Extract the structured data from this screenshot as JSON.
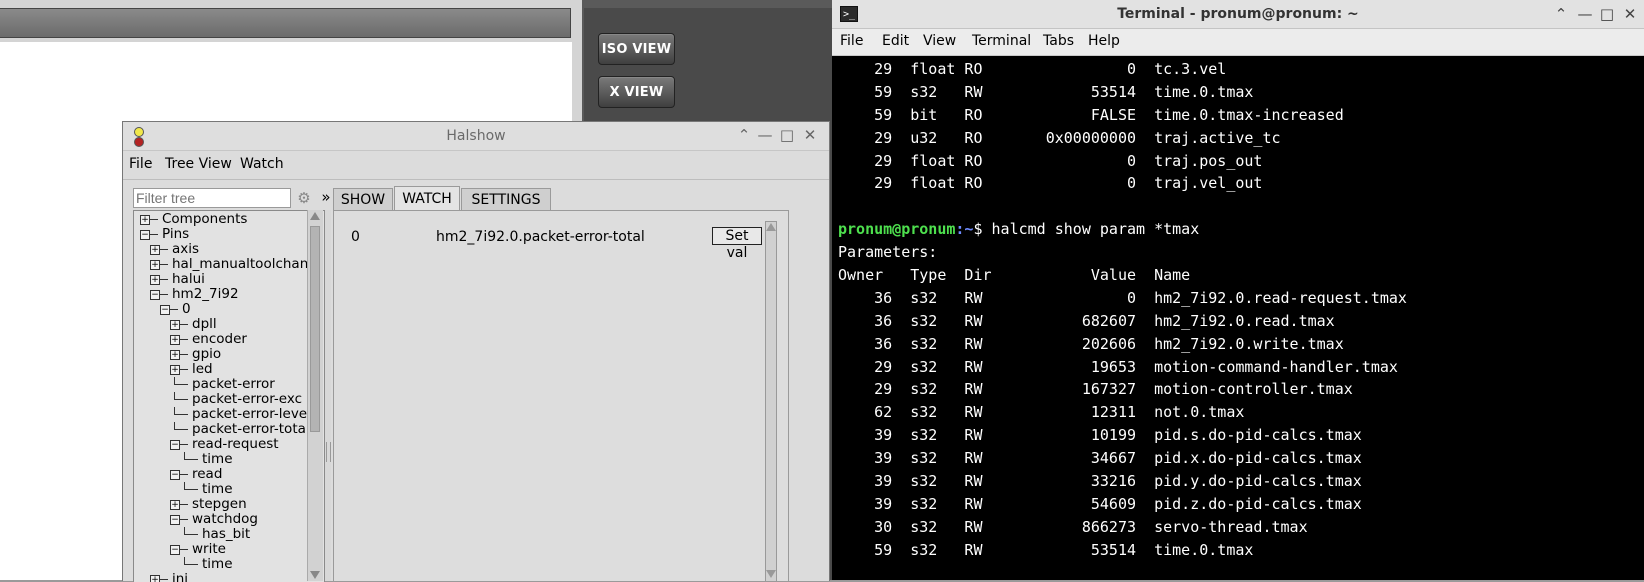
{
  "background_app": {
    "buttons": [
      "ISO VIEW",
      "X VIEW"
    ]
  },
  "halshow": {
    "title": "Halshow",
    "menu": [
      "File",
      "Tree View",
      "Watch"
    ],
    "filter_placeholder": "Filter tree",
    "more_glyph": "»",
    "tabs": [
      "SHOW",
      "WATCH",
      "SETTINGS"
    ],
    "active_tab": "WATCH",
    "tree": [
      {
        "label": "Components",
        "depth": 0,
        "expander": "+"
      },
      {
        "label": "Pins",
        "depth": 0,
        "expander": "-"
      },
      {
        "label": "axis",
        "depth": 1,
        "expander": "+"
      },
      {
        "label": "hal_manualtoolchan",
        "depth": 1,
        "expander": "+"
      },
      {
        "label": "halui",
        "depth": 1,
        "expander": "+"
      },
      {
        "label": "hm2_7i92",
        "depth": 1,
        "expander": "-"
      },
      {
        "label": "0",
        "depth": 2,
        "expander": "-"
      },
      {
        "label": "dpll",
        "depth": 3,
        "expander": "+"
      },
      {
        "label": "encoder",
        "depth": 3,
        "expander": "+"
      },
      {
        "label": "gpio",
        "depth": 3,
        "expander": "+"
      },
      {
        "label": "led",
        "depth": 3,
        "expander": "+"
      },
      {
        "label": "packet-error",
        "depth": 3,
        "expander": ""
      },
      {
        "label": "packet-error-exc",
        "depth": 3,
        "expander": ""
      },
      {
        "label": "packet-error-leve",
        "depth": 3,
        "expander": ""
      },
      {
        "label": "packet-error-tota",
        "depth": 3,
        "expander": ""
      },
      {
        "label": "read-request",
        "depth": 3,
        "expander": "-"
      },
      {
        "label": "time",
        "depth": 4,
        "expander": ""
      },
      {
        "label": "read",
        "depth": 3,
        "expander": "-"
      },
      {
        "label": "time",
        "depth": 4,
        "expander": ""
      },
      {
        "label": "stepgen",
        "depth": 3,
        "expander": "+"
      },
      {
        "label": "watchdog",
        "depth": 3,
        "expander": "-"
      },
      {
        "label": "has_bit",
        "depth": 4,
        "expander": ""
      },
      {
        "label": "write",
        "depth": 3,
        "expander": "-"
      },
      {
        "label": "time",
        "depth": 4,
        "expander": ""
      },
      {
        "label": "ini",
        "depth": 1,
        "expander": "+"
      }
    ],
    "watch": {
      "index": "0",
      "pin": "hm2_7i92.0.packet-error-total",
      "set_button": "Set val"
    }
  },
  "terminal": {
    "title": "Terminal - pronum@pronum: ~",
    "icon_glyph": ">_",
    "menu": [
      "File",
      "Edit",
      "View",
      "Terminal",
      "Tabs",
      "Help"
    ],
    "prev_rows": [
      [
        "29",
        "float",
        "RO",
        "0",
        "tc.3.vel"
      ],
      [
        "59",
        "s32",
        "RW",
        "53514",
        "time.0.tmax"
      ],
      [
        "59",
        "bit",
        "RO",
        "FALSE",
        "time.0.tmax-increased"
      ],
      [
        "29",
        "u32",
        "RO",
        "0x00000000",
        "traj.active_tc"
      ],
      [
        "29",
        "float",
        "RO",
        "0",
        "traj.pos_out"
      ],
      [
        "29",
        "float",
        "RO",
        "0",
        "traj.vel_out"
      ]
    ],
    "prompt_user": "pronum@pronum",
    "prompt_path": ":~",
    "command": "$ halcmd show param *tmax",
    "section": "Parameters:",
    "headers": [
      "Owner",
      "Type",
      "Dir",
      "Value",
      "Name"
    ],
    "rows": [
      [
        "36",
        "s32",
        "RW",
        "0",
        "hm2_7i92.0.read-request.tmax"
      ],
      [
        "36",
        "s32",
        "RW",
        "682607",
        "hm2_7i92.0.read.tmax"
      ],
      [
        "36",
        "s32",
        "RW",
        "202606",
        "hm2_7i92.0.write.tmax"
      ],
      [
        "29",
        "s32",
        "RW",
        "19653",
        "motion-command-handler.tmax"
      ],
      [
        "29",
        "s32",
        "RW",
        "167327",
        "motion-controller.tmax"
      ],
      [
        "62",
        "s32",
        "RW",
        "12311",
        "not.0.tmax"
      ],
      [
        "39",
        "s32",
        "RW",
        "10199",
        "pid.s.do-pid-calcs.tmax"
      ],
      [
        "39",
        "s32",
        "RW",
        "34667",
        "pid.x.do-pid-calcs.tmax"
      ],
      [
        "39",
        "s32",
        "RW",
        "33216",
        "pid.y.do-pid-calcs.tmax"
      ],
      [
        "39",
        "s32",
        "RW",
        "54609",
        "pid.z.do-pid-calcs.tmax"
      ],
      [
        "30",
        "s32",
        "RW",
        "866273",
        "servo-thread.tmax"
      ],
      [
        "59",
        "s32",
        "RW",
        "53514",
        "time.0.tmax"
      ]
    ]
  }
}
